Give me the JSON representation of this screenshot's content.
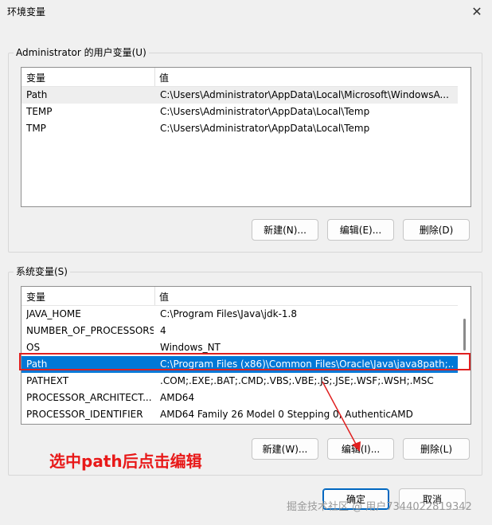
{
  "window": {
    "title": "环境变量"
  },
  "user_vars": {
    "group_label": "Administrator 的用户变量(U)",
    "col_variable": "变量",
    "col_value": "值",
    "rows": [
      {
        "name": "Path",
        "value": "C:\\Users\\Administrator\\AppData\\Local\\Microsoft\\WindowsA..."
      },
      {
        "name": "TEMP",
        "value": "C:\\Users\\Administrator\\AppData\\Local\\Temp"
      },
      {
        "name": "TMP",
        "value": "C:\\Users\\Administrator\\AppData\\Local\\Temp"
      }
    ],
    "buttons": {
      "new": "新建(N)...",
      "edit": "编辑(E)...",
      "delete": "删除(D)"
    }
  },
  "system_vars": {
    "group_label": "系统变量(S)",
    "col_variable": "变量",
    "col_value": "值",
    "rows": [
      {
        "name": "JAVA_HOME",
        "value": "C:\\Program Files\\Java\\jdk-1.8"
      },
      {
        "name": "NUMBER_OF_PROCESSORS",
        "value": "4"
      },
      {
        "name": "OS",
        "value": "Windows_NT"
      },
      {
        "name": "Path",
        "value": "C:\\Program Files (x86)\\Common Files\\Oracle\\Java\\java8path;..."
      },
      {
        "name": "PATHEXT",
        "value": ".COM;.EXE;.BAT;.CMD;.VBS;.VBE;.JS;.JSE;.WSF;.WSH;.MSC"
      },
      {
        "name": "PROCESSOR_ARCHITECT...",
        "value": "AMD64"
      },
      {
        "name": "PROCESSOR_IDENTIFIER",
        "value": "AMD64 Family 26 Model 0 Stepping 0, AuthenticAMD"
      }
    ],
    "selected_row": "Path",
    "buttons": {
      "new": "新建(W)...",
      "edit": "编辑(I)...",
      "delete": "删除(L)"
    }
  },
  "dialog_buttons": {
    "ok": "确定",
    "cancel": "取消"
  },
  "annotation": {
    "text": "选中path后点击编辑",
    "color": "#e81919"
  },
  "watermark": "掘金技术社区 @ 用户7344022819342",
  "colors": {
    "selection": "#0078d7",
    "accent": "#0067c0",
    "annotation_red": "#e02020"
  },
  "icons": {
    "close": "close-icon"
  }
}
